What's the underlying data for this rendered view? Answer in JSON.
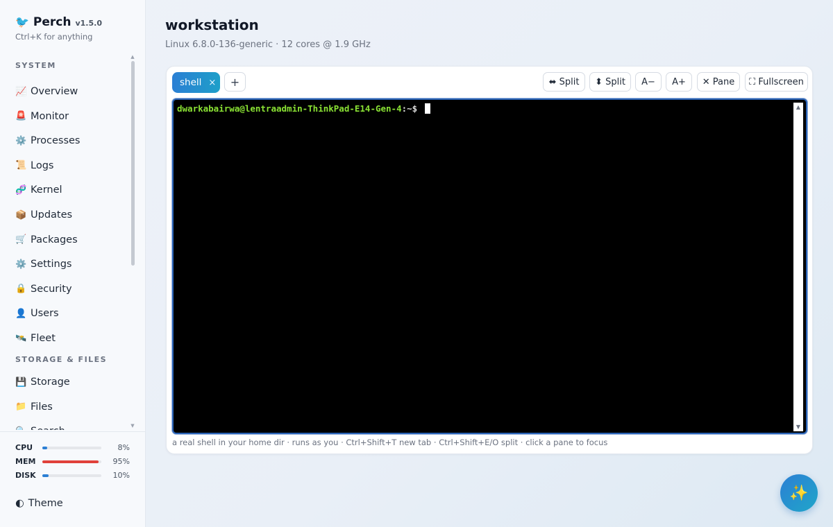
{
  "brand": {
    "icon": "🐦",
    "name": "Perch",
    "version": "v1.5.0",
    "hint": "Ctrl+K for anything"
  },
  "sidebar": {
    "sections": [
      {
        "label": "SYSTEM",
        "items": [
          {
            "icon": "📈",
            "icon_name": "chart-icon",
            "label": "Overview"
          },
          {
            "icon": "🚨",
            "icon_name": "siren-icon",
            "label": "Monitor"
          },
          {
            "icon": "⚙️",
            "icon_name": "gear-icon",
            "label": "Processes"
          },
          {
            "icon": "📜",
            "icon_name": "scroll-icon",
            "label": "Logs"
          },
          {
            "icon": "🧬",
            "icon_name": "dna-icon",
            "label": "Kernel"
          },
          {
            "icon": "📦",
            "icon_name": "package-icon",
            "label": "Updates"
          },
          {
            "icon": "🛒",
            "icon_name": "cart-icon",
            "label": "Packages"
          },
          {
            "icon": "⚙️",
            "icon_name": "gear-icon",
            "label": "Settings"
          },
          {
            "icon": "🔒",
            "icon_name": "lock-icon",
            "label": "Security"
          },
          {
            "icon": "👤",
            "icon_name": "user-icon",
            "label": "Users"
          },
          {
            "icon": "🛰️",
            "icon_name": "satellite-icon",
            "label": "Fleet"
          }
        ]
      },
      {
        "label": "STORAGE & FILES",
        "items": [
          {
            "icon": "💾",
            "icon_name": "disk-icon",
            "label": "Storage"
          },
          {
            "icon": "📁",
            "icon_name": "folder-icon",
            "label": "Files"
          },
          {
            "icon": "🔍",
            "icon_name": "search-icon",
            "label": "Search"
          }
        ]
      }
    ]
  },
  "metrics": [
    {
      "label": "CPU",
      "value": "8%",
      "fraction": 0.08,
      "color": "#2b7fd4"
    },
    {
      "label": "MEM",
      "value": "95%",
      "fraction": 0.95,
      "color": "#e0413a"
    },
    {
      "label": "DISK",
      "value": "10%",
      "fraction": 0.1,
      "color": "#2b7fd4"
    }
  ],
  "theme": {
    "icon": "◐",
    "label": "Theme"
  },
  "main": {
    "title": "workstation",
    "subtitle": "Linux 6.8.0-136-generic · 12 cores @ 1.9 GHz"
  },
  "terminal": {
    "tab_label": "shell",
    "tab_close": "×",
    "add_tab": "+",
    "toolbar": [
      {
        "name": "split-horizontal-button",
        "label": "⬌ Split"
      },
      {
        "name": "split-vertical-button",
        "label": "⬍ Split"
      },
      {
        "name": "font-decrease-button",
        "label": "A−"
      },
      {
        "name": "font-increase-button",
        "label": "A+"
      },
      {
        "name": "close-pane-button",
        "label": "✕ Pane"
      },
      {
        "name": "fullscreen-button",
        "label": "⛶ Fullscreen"
      }
    ],
    "prompt_user": "dwarkabairwa@lentraadmin-ThinkPad-E14-Gen-4",
    "prompt_path": ":~$ ",
    "help": "a real shell in your home dir · runs as you · Ctrl+Shift+T new tab · Ctrl+Shift+E/O split · click a pane to focus"
  },
  "fab": {
    "icon": "✨",
    "icon_name": "sparkles-icon"
  }
}
